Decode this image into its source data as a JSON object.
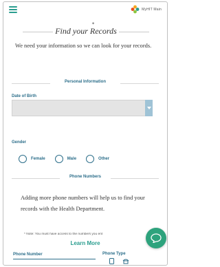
{
  "header": {
    "logo_text": "MyHIT Main",
    "brand_colors": [
      "#f4a81d",
      "#2a9d8f",
      "#8dc63f",
      "#e94e1b"
    ]
  },
  "page": {
    "title": "Find your Records",
    "intro": "We need your information so we can look for your records."
  },
  "personal_info": {
    "section_label": "Personal Information",
    "dob_label": "Date of Birth",
    "dob_value": "",
    "gender_label": "Gender",
    "gender_options": [
      "Female",
      "Male",
      "Other"
    ]
  },
  "phone_numbers": {
    "section_label": "Phone Numbers",
    "description": "Adding more phone numbers will help us to find your records with the Health Department.",
    "note": "* Note: You must have access to the numbers you ent",
    "learn_more": "Learn More",
    "phone_number_label": "Phone Number",
    "phone_type_label": "Phone Type"
  },
  "colors": {
    "accent": "#2a9d8f",
    "label": "#2c6e8a",
    "chat": "#2ea37d"
  }
}
